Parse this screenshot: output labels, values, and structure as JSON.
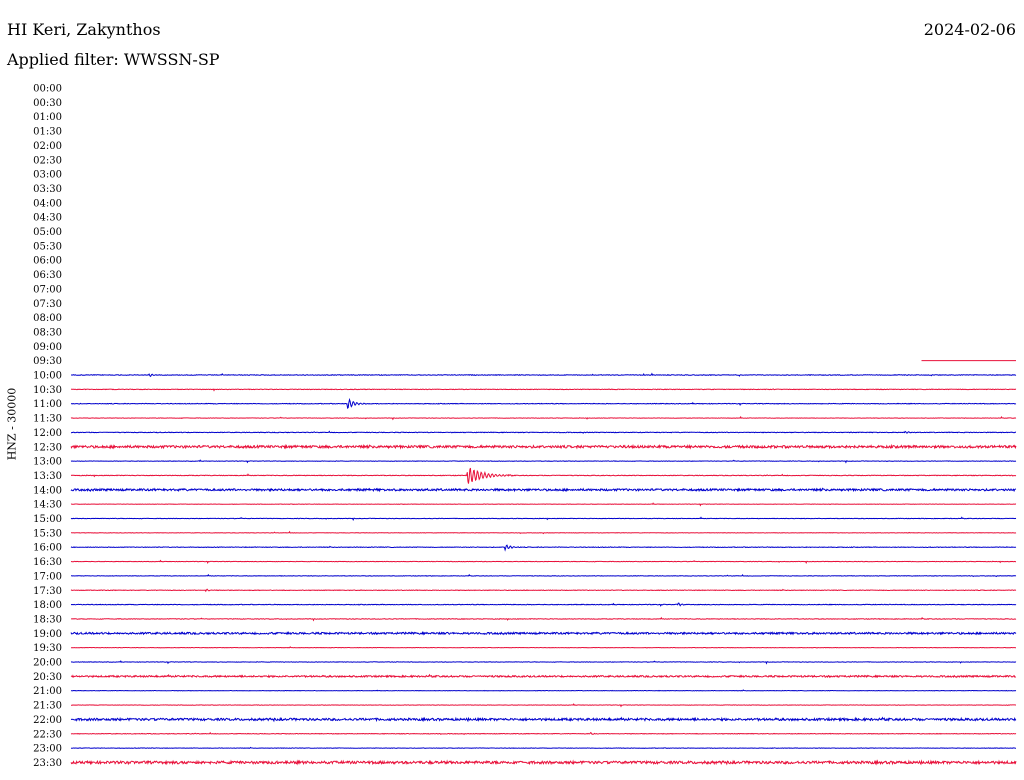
{
  "header": {
    "station": "HI Keri, Zakynthos",
    "date": "2024-02-06",
    "filter_label": "Applied filter: WWSSN-SP"
  },
  "colors": {
    "trace_blue": "#0000cc",
    "trace_red": "#e8103a",
    "text": "#000000"
  },
  "chart_data": {
    "type": "line",
    "ylabel": "HNZ - 30000",
    "row_labels": [
      "00:00",
      "00:30",
      "01:00",
      "01:30",
      "02:00",
      "02:30",
      "03:00",
      "03:30",
      "04:00",
      "04:30",
      "05:00",
      "05:30",
      "06:00",
      "06:30",
      "07:00",
      "07:30",
      "08:00",
      "08:30",
      "09:00",
      "09:30",
      "10:00",
      "10:30",
      "11:00",
      "11:30",
      "12:00",
      "12:30",
      "13:00",
      "13:30",
      "14:00",
      "14:30",
      "15:00",
      "15:30",
      "16:00",
      "16:30",
      "17:00",
      "17:30",
      "18:00",
      "18:30",
      "19:00",
      "19:30",
      "20:00",
      "20:30",
      "21:00",
      "21:30",
      "22:00",
      "22:30",
      "23:00",
      "23:30"
    ],
    "row_colors": [
      "blue",
      "red",
      "blue",
      "red",
      "blue",
      "red",
      "blue",
      "red",
      "blue",
      "red",
      "blue",
      "red",
      "blue",
      "red",
      "blue",
      "red",
      "blue",
      "red",
      "blue",
      "red",
      "blue",
      "red",
      "blue",
      "red",
      "blue",
      "red",
      "blue",
      "red",
      "blue",
      "red",
      "blue",
      "red",
      "blue",
      "red",
      "blue",
      "red",
      "blue",
      "red",
      "blue",
      "red",
      "blue",
      "red",
      "blue",
      "red",
      "blue",
      "red",
      "blue",
      "red"
    ],
    "x_range_minutes": [
      0,
      30
    ],
    "record_start": {
      "row": "09:30",
      "minute": 27
    },
    "noise_level": {
      "09:30": 0,
      "10:00": 0.3,
      "10:30": 0.3,
      "11:00": 0.3,
      "11:30": 0.2,
      "12:00": 0.3,
      "12:30": 1.2,
      "13:00": 0.2,
      "13:30": 0.3,
      "14:00": 1.0,
      "14:30": 0.2,
      "15:00": 0.2,
      "15:30": 0.2,
      "16:00": 0.3,
      "16:30": 0.2,
      "17:00": 0.2,
      "17:30": 0.3,
      "18:00": 0.3,
      "18:30": 0.3,
      "19:00": 0.9,
      "19:30": 0.2,
      "20:00": 0.2,
      "20:30": 0.8,
      "21:00": 0.2,
      "21:30": 0.2,
      "22:00": 1.1,
      "22:30": 0.3,
      "23:00": 0.2,
      "23:30": 1.3
    },
    "events": [
      {
        "row": "10:00",
        "minute": 2.5,
        "amplitude": 1.5,
        "duration_min": 0.3
      },
      {
        "row": "11:00",
        "minute": 8.8,
        "amplitude": 5,
        "duration_min": 0.6
      },
      {
        "row": "12:00",
        "minute": 26.5,
        "amplitude": 1.2,
        "duration_min": 0.3
      },
      {
        "row": "13:30",
        "minute": 12.6,
        "amplitude": 9,
        "duration_min": 1.4
      },
      {
        "row": "16:00",
        "minute": 13.8,
        "amplitude": 2.5,
        "duration_min": 0.6
      },
      {
        "row": "17:30",
        "minute": 4.3,
        "amplitude": 1.3,
        "duration_min": 0.3
      },
      {
        "row": "18:00",
        "minute": 19.3,
        "amplitude": 1.8,
        "duration_min": 0.2
      },
      {
        "row": "22:30",
        "minute": 16.5,
        "amplitude": 1.4,
        "duration_min": 0.2
      }
    ]
  }
}
